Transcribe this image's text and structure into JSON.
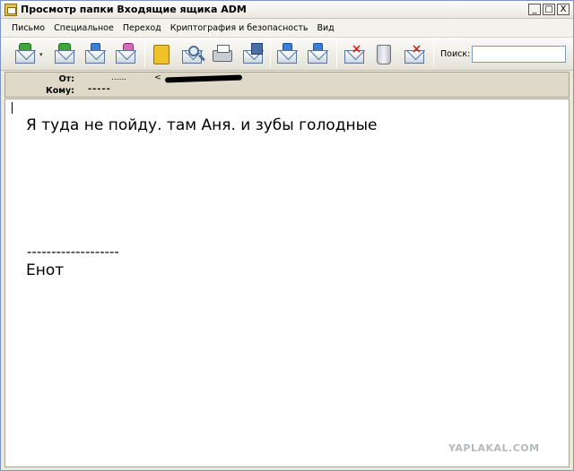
{
  "window": {
    "title": "Просмотр папки Входящие ящика ADM",
    "minimize": "_",
    "maximize": "□",
    "close": "X"
  },
  "menu": {
    "items": [
      {
        "label": "Письмо"
      },
      {
        "label": "Специальное"
      },
      {
        "label": "Переход"
      },
      {
        "label": "Криптография и безопасность"
      },
      {
        "label": "Вид"
      }
    ]
  },
  "toolbar": {
    "buttons": [
      {
        "icon": "receive-mail-icon"
      },
      {
        "icon": "reply-all-icon"
      },
      {
        "icon": "reply-icon"
      },
      {
        "icon": "forward-icon"
      },
      {
        "icon": "address-book-icon"
      },
      {
        "icon": "find-icon"
      },
      {
        "icon": "print-icon"
      },
      {
        "icon": "save-icon"
      },
      {
        "icon": "previous-message-icon"
      },
      {
        "icon": "next-message-icon"
      },
      {
        "icon": "delete-message-icon"
      },
      {
        "icon": "trash-icon"
      },
      {
        "icon": "delete-permanently-icon"
      }
    ],
    "dropdown_arrow": "▾",
    "search_label": "Поиск:",
    "search_value": ""
  },
  "message_header": {
    "from_label": "От:",
    "from_value": "......",
    "from_email": "<",
    "to_label": "Кому:",
    "to_value": "-----"
  },
  "message_body": {
    "text": "Я туда не пойду. там Аня. и зубы голодные",
    "signature_separator": "-------------------",
    "signature": "Енот"
  },
  "watermark": "YAPLAKAL.COM",
  "colors": {
    "window_bg": "#ece9d8",
    "header_bg": "#ded9c8",
    "body_bg": "#ffffff"
  }
}
